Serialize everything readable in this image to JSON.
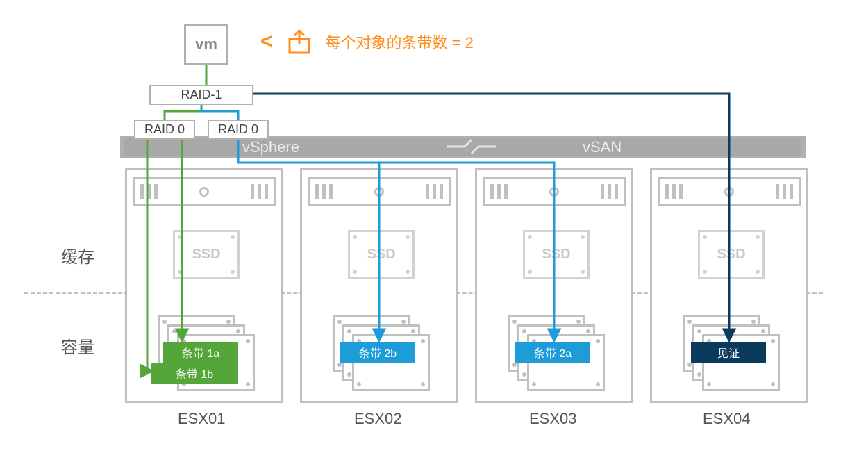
{
  "vm": {
    "label": "vm"
  },
  "annotation": {
    "arrow": "<",
    "text": "每个对象的条带数 = 2"
  },
  "raid": {
    "r1": "RAID-1",
    "r0a": "RAID 0",
    "r0b": "RAID 0"
  },
  "banner": {
    "left": "vSphere",
    "right": "vSAN"
  },
  "row_labels": {
    "cache": "缓存",
    "capacity": "容量"
  },
  "ssd": {
    "label": "SSD"
  },
  "hosts": [
    {
      "name": "ESX01"
    },
    {
      "name": "ESX02"
    },
    {
      "name": "ESX03"
    },
    {
      "name": "ESX04"
    }
  ],
  "stripes": {
    "s1a": "条带 1a",
    "s1b": "条带 1b",
    "s2a": "条带 2a",
    "s2b": "条带 2b",
    "witness": "见证"
  },
  "colors": {
    "green": "#55a63a",
    "blue": "#1e9cd8",
    "darkblue": "#0a3a5c",
    "orange": "#ff8c1a",
    "gray": "#b0b0b0"
  }
}
